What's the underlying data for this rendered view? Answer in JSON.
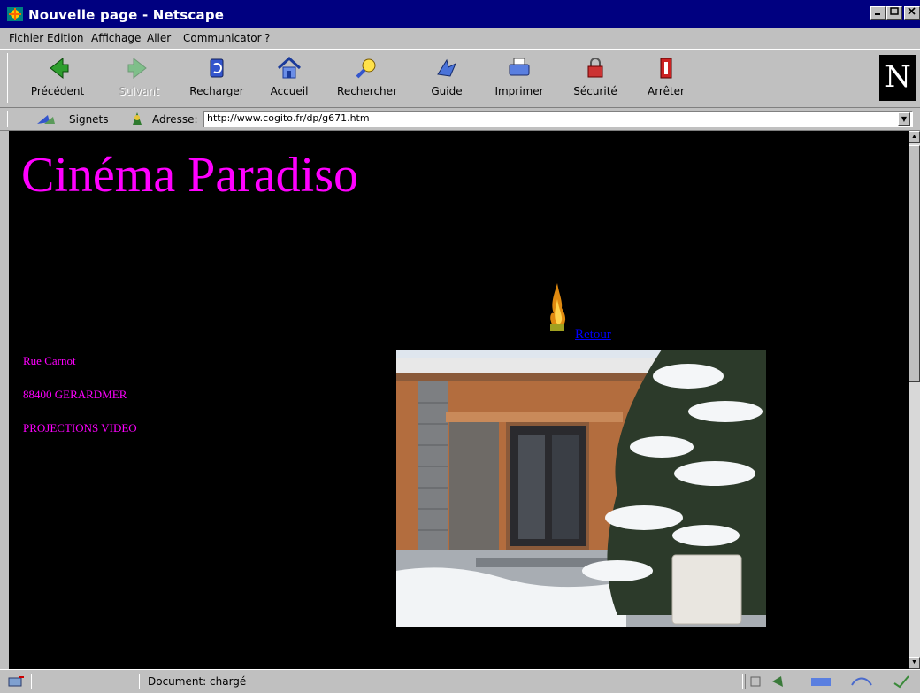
{
  "window": {
    "title": "Nouvelle page - Netscape"
  },
  "menu": {
    "items": [
      {
        "label": "Fichier"
      },
      {
        "label": "Edition"
      },
      {
        "label": "Affichage"
      },
      {
        "label": "Aller"
      },
      {
        "label": "Communicator"
      },
      {
        "label": "?"
      }
    ]
  },
  "toolbar": {
    "buttons": [
      {
        "label": "Précédent",
        "icon": "back-arrow-icon",
        "enabled": true
      },
      {
        "label": "Suivant",
        "icon": "forward-arrow-icon",
        "enabled": false
      },
      {
        "label": "Recharger",
        "icon": "reload-icon",
        "enabled": true
      },
      {
        "label": "Accueil",
        "icon": "home-icon",
        "enabled": true
      },
      {
        "label": "Rechercher",
        "icon": "search-icon",
        "enabled": true
      },
      {
        "label": "Guide",
        "icon": "guide-icon",
        "enabled": true
      },
      {
        "label": "Imprimer",
        "icon": "print-icon",
        "enabled": true
      },
      {
        "label": "Sécurité",
        "icon": "security-lock-icon",
        "enabled": true
      },
      {
        "label": "Arrêter",
        "icon": "stop-icon",
        "enabled": true
      }
    ],
    "logo_letter": "N"
  },
  "location": {
    "bookmarks_label": "Signets",
    "address_label": "Adresse:",
    "url": "http://www.cogito.fr/dp/g671.htm"
  },
  "page": {
    "title": "Cinéma Paradiso",
    "address_lines": [
      "Rue Carnot",
      "88400 GERARDMER",
      "PROJECTIONS VIDEO"
    ],
    "retour_link": "Retour"
  },
  "status": {
    "text": "Document: chargé"
  },
  "colors": {
    "title_bar": "#000080",
    "chrome": "#c0c0c0",
    "page_background": "#000000",
    "page_text": "#ff00ff",
    "link": "#0000ff"
  }
}
